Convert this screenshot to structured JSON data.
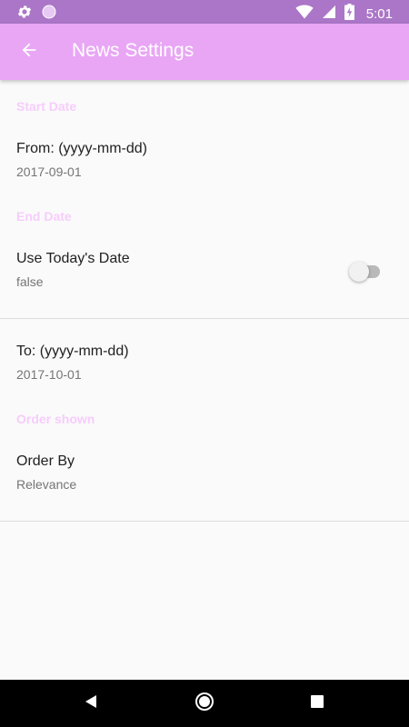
{
  "status_bar": {
    "time": "5:01",
    "icons": [
      "gear-icon",
      "circle-icon",
      "wifi-icon",
      "signal-icon",
      "battery-charging-icon"
    ]
  },
  "app_bar": {
    "back_icon": "arrow-left-icon",
    "title": "News Settings"
  },
  "colors": {
    "status_bar": "#ab76c7",
    "app_bar": "#e9a6f5",
    "category_title": "#f6cdfc",
    "background": "#fafafa"
  },
  "settings": {
    "start_date": {
      "category": "Start Date",
      "from": {
        "title": "From: (yyyy-mm-dd)",
        "summary": "2017-09-01"
      }
    },
    "end_date": {
      "category": "End Date",
      "use_today": {
        "title": "Use Today's Date",
        "summary": "false",
        "checked": false
      },
      "to": {
        "title": "To: (yyyy-mm-dd)",
        "summary": "2017-10-01"
      }
    },
    "order": {
      "category": "Order shown",
      "order_by": {
        "title": "Order By",
        "summary": "Relevance"
      }
    }
  },
  "nav_bar": {
    "icons": [
      "back-triangle-icon",
      "home-circle-icon",
      "recents-square-icon"
    ]
  }
}
